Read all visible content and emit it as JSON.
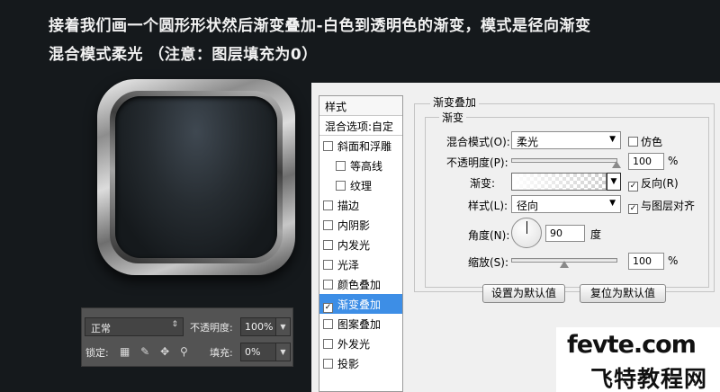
{
  "caption": {
    "line1": "接着我们画一个圆形形状然后渐变叠加-白色到透明色的渐变，模式是径向渐变",
    "line2": "混合模式柔光    （注意：图层填充为0）"
  },
  "layers_panel": {
    "blend_mode": "正常",
    "opacity_label": "不透明度:",
    "opacity_value": "100%",
    "lock_label": "锁定:",
    "fill_label": "填充:",
    "fill_value": "0%",
    "lock_icons": [
      "checker-lock-icon",
      "brush-lock-icon",
      "move-lock-icon",
      "padlock-icon"
    ]
  },
  "dialog": {
    "styles_header": "样式",
    "blend_options": "混合选项:自定",
    "styles": [
      {
        "label": "斜面和浮雕",
        "checked": false,
        "sub": false,
        "active": false
      },
      {
        "label": "等高线",
        "checked": false,
        "sub": true,
        "active": false
      },
      {
        "label": "纹理",
        "checked": false,
        "sub": true,
        "active": false
      },
      {
        "label": "描边",
        "checked": false,
        "sub": false,
        "active": false
      },
      {
        "label": "内阴影",
        "checked": false,
        "sub": false,
        "active": false
      },
      {
        "label": "内发光",
        "checked": false,
        "sub": false,
        "active": false
      },
      {
        "label": "光泽",
        "checked": false,
        "sub": false,
        "active": false
      },
      {
        "label": "颜色叠加",
        "checked": false,
        "sub": false,
        "active": false
      },
      {
        "label": "渐变叠加",
        "checked": true,
        "sub": false,
        "active": true
      },
      {
        "label": "图案叠加",
        "checked": false,
        "sub": false,
        "active": false
      },
      {
        "label": "外发光",
        "checked": false,
        "sub": false,
        "active": false
      },
      {
        "label": "投影",
        "checked": false,
        "sub": false,
        "active": false
      }
    ],
    "section_title": "渐变叠加",
    "group_title": "渐变",
    "blend_mode_label": "混合模式(O):",
    "blend_mode_value": "柔光",
    "dither_label": "仿色",
    "dither_checked": false,
    "opacity_label": "不透明度(P):",
    "opacity_value": "100",
    "opacity_level": 1.0,
    "percent": "%",
    "gradient_label": "渐变:",
    "reverse_label": "反向(R)",
    "reverse_checked": true,
    "style_label": "样式(L):",
    "style_value": "径向",
    "align_label": "与图层对齐",
    "align_checked": true,
    "angle_label": "角度(N):",
    "angle_value": "90",
    "degree": "度",
    "scale_label": "缩放(S):",
    "scale_value": "100",
    "scale_level": 0.5,
    "btn_default": "设置为默认值",
    "btn_reset": "复位为默认值"
  },
  "watermark": {
    "top": "fevte.com",
    "bottom": "飞特教程网"
  }
}
